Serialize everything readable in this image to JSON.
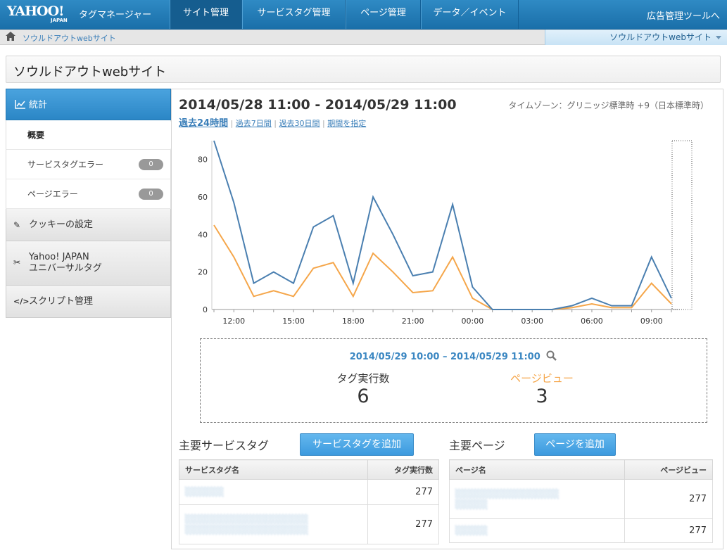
{
  "header": {
    "logo_main": "YAHOO!",
    "logo_sub": "JAPAN",
    "product": "タグマネージャー",
    "tabs": [
      {
        "label": "サイト管理",
        "active": true
      },
      {
        "label": "サービスタグ管理",
        "active": false
      },
      {
        "label": "ページ管理",
        "active": false
      },
      {
        "label": "データ／イベント",
        "active": false
      }
    ],
    "ad_tool_link": "広告管理ツールへ"
  },
  "breadcrumb": {
    "site": "ソウルドアウトwebサイト",
    "selected_site": "ソウルドアウトwebサイト"
  },
  "page_title": "ソウルドアウトwebサイト",
  "sidebar": {
    "section": "統計",
    "sub_items": [
      {
        "label": "概要",
        "active": true
      },
      {
        "label": "サービスタグエラー",
        "badge": "0"
      },
      {
        "label": "ページエラー",
        "badge": "0"
      }
    ],
    "items": [
      {
        "label": "クッキーの設定",
        "icon": "pencil-icon"
      },
      {
        "label": "Yahoo! JAPAN",
        "label2": "ユニバーサルタグ",
        "icon": "scissors-icon"
      },
      {
        "label": "スクリプト管理",
        "icon": "code-icon"
      }
    ]
  },
  "stats": {
    "range": "2014/05/28 11:00 - 2014/05/29 11:00",
    "timezone": "タイムゾーン：グリニッジ標準時 +9（日本標準時）",
    "periods": [
      "過去24時間",
      "過去7日間",
      "過去30日間",
      "期間を指定"
    ],
    "summary_range": "2014/05/29 10:00 – 2014/05/29 11:00",
    "tag_exec_label": "タグ実行数",
    "tag_exec_value": "6",
    "pageview_label": "ページビュー",
    "pageview_value": "3"
  },
  "chart_data": {
    "type": "line",
    "x_tick_labels": [
      "12:00",
      "15:00",
      "18:00",
      "21:00",
      "00:00",
      "03:00",
      "06:00",
      "09:00"
    ],
    "ylim": [
      0,
      90
    ],
    "y_ticks": [
      0,
      20,
      40,
      60,
      80
    ],
    "series": [
      {
        "color": "#4a7fb0",
        "values": [
          90,
          57,
          14,
          20,
          14,
          44,
          50,
          14,
          60,
          40,
          18,
          20,
          56,
          12,
          0,
          0,
          0,
          0,
          2,
          6,
          2,
          2,
          28,
          6
        ]
      },
      {
        "color": "#f5a64a",
        "values": [
          45,
          28,
          7,
          10,
          7,
          22,
          25,
          7,
          30,
          20,
          9,
          10,
          28,
          6,
          0,
          0,
          0,
          0,
          1,
          3,
          1,
          1,
          14,
          3
        ]
      }
    ],
    "colors": {
      "tag": "#4a7fb0",
      "pageview": "#f5a64a"
    }
  },
  "service_tags": {
    "title": "主要サービスタグ",
    "add_button": "サービスタグを追加",
    "col_name": "サービスタグ名",
    "col_count": "タグ実行数",
    "rows": [
      {
        "count": "277"
      },
      {
        "count": "277"
      }
    ]
  },
  "pages": {
    "title": "主要ページ",
    "add_button": "ページを追加",
    "col_name": "ページ名",
    "col_count": "ページビュー",
    "rows": [
      {
        "count": "277"
      },
      {
        "count": "277"
      }
    ]
  }
}
